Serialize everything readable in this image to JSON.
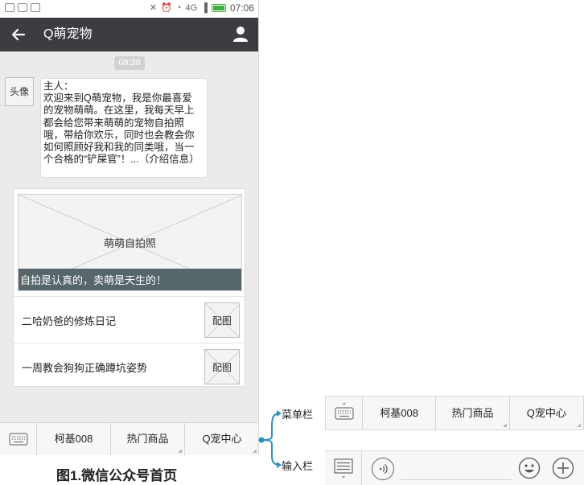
{
  "status_bar": {
    "time": "07:06",
    "network": "4G"
  },
  "titlebar": {
    "title": "Q萌宠物"
  },
  "chat": {
    "timestamp": "08:38",
    "avatar_label": "头像",
    "message_lines": [
      "主人：",
      "欢迎来到Q萌宠物，我是你最喜爱",
      "的宠物萌萌。在这里，我每天早上",
      "都会给您带来萌萌的宠物自拍照",
      "哦，带给你欢乐，同时也会教会你",
      "如何照顾好我和我的同类哦，当一",
      "个合格的“铲屎官”！...（介绍信息）"
    ]
  },
  "news": {
    "cover_label": "萌萌自拍照",
    "cover_caption": "自拍是认真的，卖萌是天生的！",
    "items": [
      {
        "title": "二哈奶爸的修炼日记",
        "thumb_label": "配图"
      },
      {
        "title": "一周教会狗狗正确蹲坑姿势",
        "thumb_label": "配图"
      }
    ]
  },
  "menu": {
    "items": [
      "柯基008",
      "热门商品",
      "Q宠中心"
    ]
  },
  "figure_caption": "图1.微信公众号首页",
  "annotations": {
    "menu_bar_label": "菜单栏",
    "input_bar_label": "输入栏"
  },
  "colors": {
    "titlebar_bg": "#3c3d41",
    "caption_bg": "#56666b",
    "annotation_blue": "#2a8fc4",
    "battery_green": "#3bb03b"
  },
  "icons": [
    "back-arrow-icon",
    "user-icon",
    "keyboard-icon",
    "list-icon",
    "voice-icon",
    "emoji-icon",
    "plus-icon"
  ]
}
